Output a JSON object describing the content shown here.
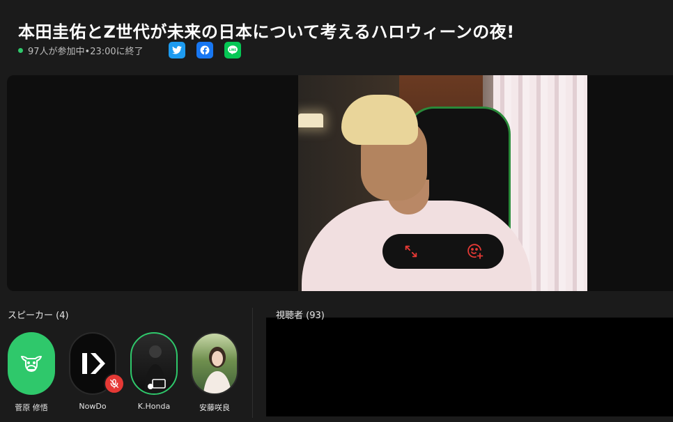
{
  "header": {
    "title": "本田圭佑とZ世代が未来の日本について考えるハロウィーンの夜!",
    "status": "97人が参加中•23:00に終了",
    "status_color": "#2fc86b",
    "share": {
      "twitter_icon": "twitter-icon",
      "facebook_icon": "facebook-icon",
      "line_icon": "line-icon"
    }
  },
  "stage": {
    "overlay_controls": {
      "expand_icon": "expand-icon",
      "reaction_icon": "add-reaction-icon",
      "accent_color": "#e53935"
    }
  },
  "speakers": {
    "label": "スピーカー (4)",
    "items": [
      {
        "name": "菅原 修悟",
        "avatar": "cow-icon"
      },
      {
        "name": "NowDo",
        "avatar": "nowdo-logo",
        "muted": true
      },
      {
        "name": "K.Honda",
        "avatar": "photo",
        "speaking": true
      },
      {
        "name": "安藤咲良",
        "avatar": "photo"
      }
    ]
  },
  "viewers": {
    "label": "視聴者 (93)"
  }
}
